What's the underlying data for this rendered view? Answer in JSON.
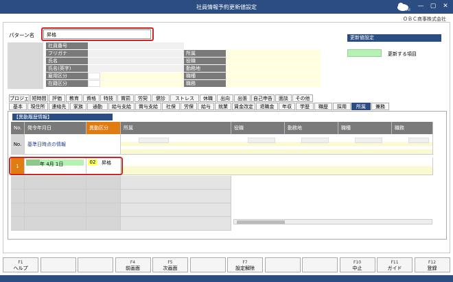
{
  "window": {
    "title": "社員情報予約更新値設定",
    "company": "ＯＢＣ商事株式会社",
    "logo_text": "AI",
    "controls": [
      "—",
      "▢",
      "✕"
    ]
  },
  "pattern": {
    "label": "パターン名",
    "value": "昇格"
  },
  "employee_fields": {
    "left": [
      "社員番号",
      "フリガナ",
      "氏名",
      "氏名(英字)",
      "雇用区分",
      "在籍区分"
    ],
    "right": [
      "所属",
      "役職",
      "勤務地",
      "職種",
      "職務"
    ]
  },
  "legend": {
    "header": "更新値設定",
    "item_label": "更新する項目"
  },
  "tabs_row1": [
    "プロジェ",
    "短時間",
    "評価",
    "教育",
    "資格",
    "特技",
    "賞罰",
    "労契",
    "健診",
    "ストレス",
    "休職",
    "出向",
    "出張",
    "自己申告",
    "面談",
    "その他"
  ],
  "tabs_row2": [
    "基本",
    "現住所",
    "連絡先",
    "家族",
    "通勤",
    "給与支給",
    "賞与支給",
    "社保",
    "労保",
    "給与",
    "就業",
    "賃金改定",
    "退職金",
    "年収",
    "学歴",
    "職歴",
    "採用",
    "所属",
    "兼務"
  ],
  "active_tab": "所属",
  "section_title": "【異動履歴情報】",
  "table": {
    "headers": [
      "No.",
      "発令年月日",
      "異動区分",
      "所属",
      "役職",
      "勤務地",
      "職種",
      "職務"
    ],
    "base_row": {
      "no": "No.",
      "label": "基準日時点の情報"
    },
    "row1": {
      "no": "1",
      "date": "年  4月  1日",
      "code": "02",
      "kubun": "昇格"
    }
  },
  "fkeys": [
    {
      "key": "F1",
      "label": "ヘルプ"
    },
    {
      "key": "",
      "label": ""
    },
    {
      "key": "",
      "label": ""
    },
    {
      "key": "F4",
      "label": "前画面"
    },
    {
      "key": "F5",
      "label": "次画面"
    },
    {
      "key": "",
      "label": ""
    },
    {
      "key": "F7",
      "label": "設定解除"
    },
    {
      "key": "",
      "label": ""
    },
    {
      "key": "",
      "label": ""
    },
    {
      "key": "F10",
      "label": "中止"
    },
    {
      "key": "F11",
      "label": "ガイド"
    },
    {
      "key": "F12",
      "label": "登録"
    }
  ],
  "colors": {
    "accent": "#2b4d82",
    "orange": "#e07b12",
    "highlight": "#d92020",
    "update_green": "#b3f2b3"
  }
}
